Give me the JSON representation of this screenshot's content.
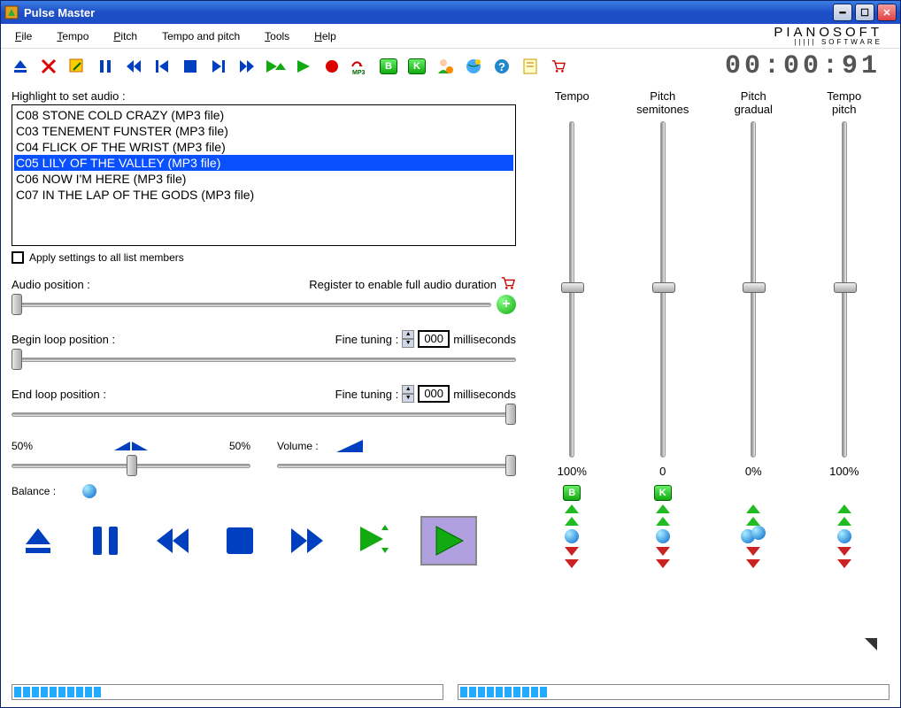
{
  "window": {
    "title": "Pulse Master"
  },
  "menu": {
    "file": "File",
    "tempo": "Tempo",
    "pitch": "Pitch",
    "tempo_pitch": "Tempo and pitch",
    "tools": "Tools",
    "help": "Help"
  },
  "brand": {
    "line1": "PIANOSOFT",
    "line2": "||||| SOFTWARE"
  },
  "timecode": "00:00:91",
  "list": {
    "label": "Highlight to set audio :",
    "items": [
      "C08 STONE COLD CRAZY (MP3 file)",
      "C03 TENEMENT FUNSTER (MP3 file)",
      "C04 FLICK OF THE  WRIST (MP3 file)",
      "C05 LILY OF THE VALLEY (MP3 file)",
      "C06 NOW I'M HERE (MP3 file)",
      "C07 IN THE LAP OF THE GODS (MP3 file)"
    ],
    "selected_index": 3
  },
  "apply_all": "Apply settings to all list members",
  "audio_pos": {
    "label": "Audio position :",
    "register": "Register to enable full audio duration"
  },
  "begin_loop": {
    "label": "Begin loop position :",
    "fine": "Fine tuning :",
    "ms_value": "000",
    "ms_unit": "milliseconds"
  },
  "end_loop": {
    "label": "End loop position :",
    "fine": "Fine tuning :",
    "ms_value": "000",
    "ms_unit": "milliseconds"
  },
  "balance": {
    "left": "50%",
    "right": "50%",
    "label": "Balance :"
  },
  "volume": {
    "label": "Volume :"
  },
  "sliders": {
    "headers": [
      "Tempo",
      "Pitch semitones",
      "Pitch gradual",
      "Tempo pitch"
    ],
    "values": [
      "100%",
      "0",
      "0%",
      "100%"
    ]
  },
  "adjbtns": {
    "b": "B",
    "k": "K"
  }
}
